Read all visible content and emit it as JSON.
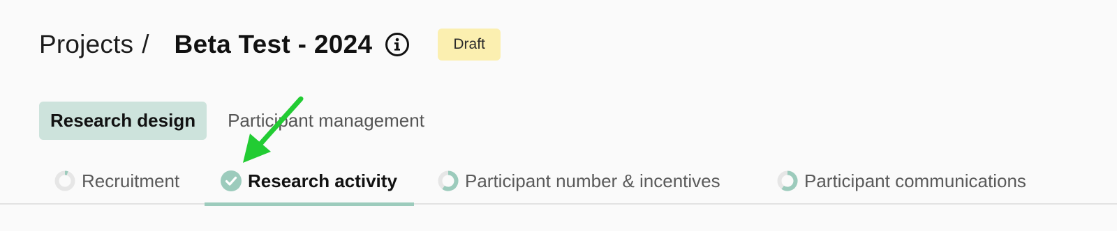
{
  "header": {
    "breadcrumb_root": "Projects",
    "breadcrumb_separator": "/",
    "title": "Beta Test - 2024",
    "info_icon": "info-circle-icon",
    "status": "Draft"
  },
  "primary_tabs": [
    {
      "label": "Research design",
      "active": true
    },
    {
      "label": "Participant management",
      "active": false
    }
  ],
  "steps": [
    {
      "label": "Recruitment",
      "icon": "progress-ring-icon",
      "progress": 0.05,
      "active": false
    },
    {
      "label": "Research activity",
      "icon": "check-circle-icon",
      "progress": 1,
      "active": true
    },
    {
      "label": "Participant number & incentives",
      "icon": "progress-ring-icon",
      "progress": 0.6,
      "active": false
    },
    {
      "label": "Participant communications",
      "icon": "progress-ring-icon",
      "progress": 0.6,
      "active": false
    }
  ],
  "colors": {
    "accent": "#9ccbbc",
    "accent_fill": "#cde3dc",
    "badge_bg": "#fbefb0",
    "arrow": "#22cc33",
    "ring_track": "#e6e6e6"
  },
  "annotation": {
    "icon": "arrow-pointer-icon"
  }
}
